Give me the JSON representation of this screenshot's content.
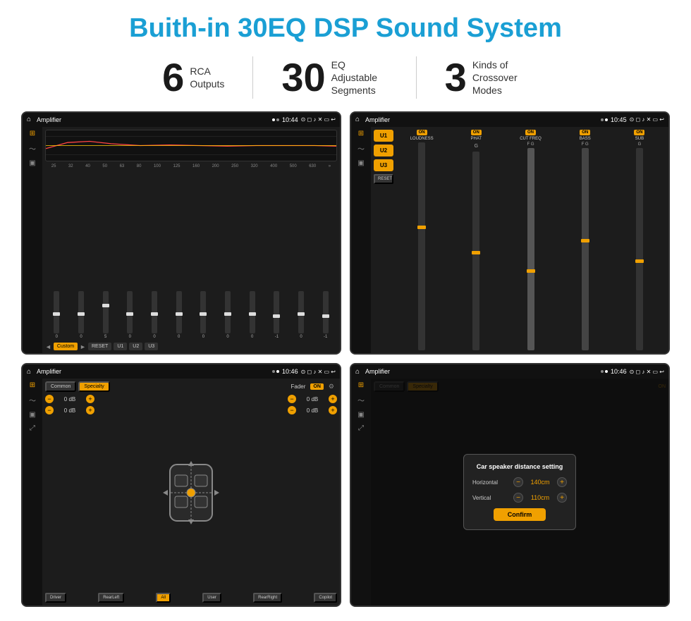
{
  "title": "Buith-in 30EQ DSP Sound System",
  "stats": [
    {
      "number": "6",
      "text": "RCA\nOutputs"
    },
    {
      "number": "30",
      "text": "EQ Adjustable\nSegments"
    },
    {
      "number": "3",
      "text": "Kinds of\nCrossover Modes"
    }
  ],
  "screens": [
    {
      "id": "screen-eq",
      "statusbar": {
        "title": "Amplifier",
        "time": "10:44",
        "icons": "⊙ ▶"
      },
      "eq": {
        "bands": [
          "25",
          "32",
          "40",
          "50",
          "63",
          "80",
          "100",
          "125",
          "160",
          "200",
          "250",
          "320",
          "400",
          "500",
          "630"
        ],
        "values": [
          "0",
          "0",
          "0",
          "5",
          "0",
          "0",
          "0",
          "0",
          "0",
          "0",
          "-1",
          "0",
          "-1"
        ],
        "bottomButtons": [
          "Custom",
          "RESET",
          "U1",
          "U2",
          "U3"
        ]
      }
    },
    {
      "id": "screen-amp2",
      "statusbar": {
        "title": "Amplifier",
        "time": "10:45",
        "icons": "■ ●"
      },
      "channels": {
        "uButtons": [
          "U1",
          "U2",
          "U3"
        ],
        "cols": [
          "LOUDNESS",
          "PHAT",
          "CUT FREQ",
          "BASS",
          "SUB"
        ],
        "resetBtn": "RESET"
      }
    },
    {
      "id": "screen-fader",
      "statusbar": {
        "title": "Amplifier",
        "time": "10:46",
        "icons": "■ ●"
      },
      "fader": {
        "tabs": [
          "Common",
          "Specialty"
        ],
        "label": "Fader",
        "onBtn": "ON",
        "leftValues": [
          "0 dB",
          "0 dB"
        ],
        "rightValues": [
          "0 dB",
          "0 dB"
        ],
        "bottomBtns": [
          "Driver",
          "RearLeft",
          "All",
          "User",
          "RearRight",
          "Copilot"
        ]
      }
    },
    {
      "id": "screen-dialog",
      "statusbar": {
        "title": "Amplifier",
        "time": "10:46",
        "icons": "■ ●"
      },
      "fader": {
        "tabs": [
          "Common",
          "Specialty"
        ],
        "onBtn": "ON"
      },
      "dialog": {
        "title": "Car speaker distance setting",
        "horizontal": {
          "label": "Horizontal",
          "value": "140cm"
        },
        "vertical": {
          "label": "Vertical",
          "value": "110cm"
        },
        "confirmBtn": "Confirm"
      }
    }
  ],
  "icons": {
    "home": "⌂",
    "back": "↩",
    "location": "⊙",
    "camera": "◻",
    "sound": "♪",
    "close": "✕",
    "minus": "−",
    "plus": "+"
  }
}
